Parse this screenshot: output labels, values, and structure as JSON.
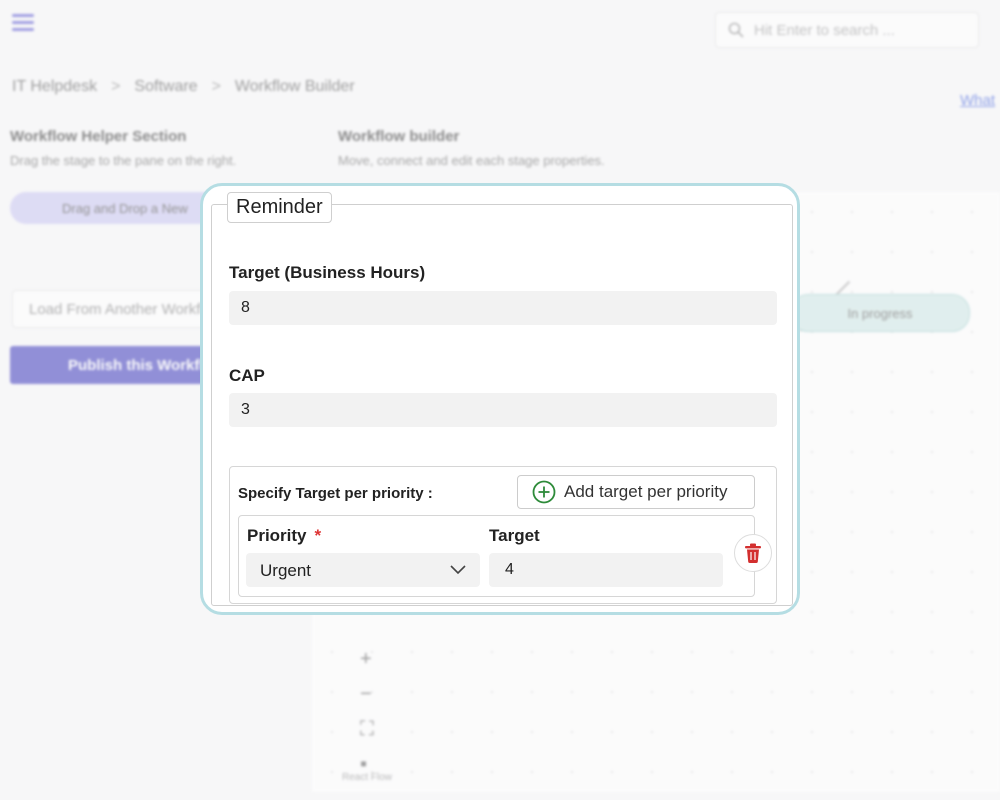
{
  "header": {
    "search_placeholder": "Hit Enter to search ..."
  },
  "breadcrumb": [
    "IT Helpdesk",
    "Software",
    "Workflow Builder"
  ],
  "breadcrumb_separator": ">",
  "whats_link": "What",
  "helper": {
    "title": "Workflow Helper Section",
    "subtitle": "Drag the stage to the pane on the right.",
    "drag_label": "Drag and Drop a New",
    "load_placeholder": "Load From Another Workflow",
    "publish_label": "Publish this Workflow"
  },
  "builder": {
    "title": "Workflow builder",
    "subtitle": "Move, connect and edit each stage properties.",
    "node_in_progress": "In progress",
    "react_flow_label": "React Flow"
  },
  "modal": {
    "legend": "Reminder",
    "target_label": "Target (Business Hours)",
    "target_value": "8",
    "cap_label": "CAP",
    "cap_value": "3",
    "specify_label": "Specify Target per priority :",
    "add_button_label": "Add target per priority",
    "priority_label": "Priority",
    "required_mark": "*",
    "target_col_label": "Target",
    "priority_value": "Urgent",
    "priority_target_value": "4"
  },
  "colors": {
    "accent": "#3f3bbd",
    "modal_border": "#b5dde3",
    "add_icon": "#2e8b3a",
    "delete_icon": "#d32f2f"
  },
  "icons": [
    "hamburger-icon",
    "search-icon",
    "add-circle-icon",
    "chevron-down-icon",
    "trash-icon",
    "zoom-in-icon",
    "zoom-out-icon",
    "fit-view-icon",
    "lock-icon"
  ]
}
